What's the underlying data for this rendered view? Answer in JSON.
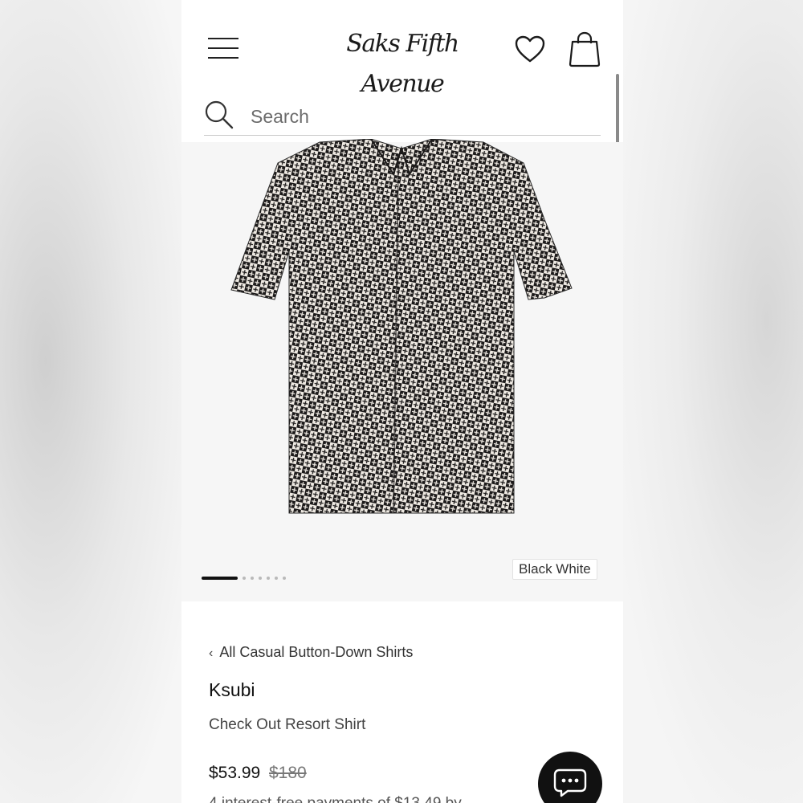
{
  "header": {
    "logo_text": "Saks Fifth Avenue",
    "menu_icon": "hamburger-menu-icon",
    "wishlist_icon": "heart-icon",
    "bag_icon": "shopping-bag-icon"
  },
  "search": {
    "placeholder": "Search",
    "icon": "magnifier-icon"
  },
  "gallery": {
    "image_count": 7,
    "current_image": 1,
    "color_label": "Black White"
  },
  "product": {
    "breadcrumb": "All Casual Button-Down Shirts",
    "brand": "Ksubi",
    "name": "Check Out Resort Shirt",
    "price": "$53.99",
    "original_price": "$180",
    "installments_text": "4 interest-free payments of $13.49 by"
  },
  "chat": {
    "icon": "chat-bubble-icon"
  },
  "colors": {
    "background": "#ffffff",
    "text": "#111111",
    "gallery_bg": "#f6f6f6",
    "chat_button": "#111111"
  }
}
